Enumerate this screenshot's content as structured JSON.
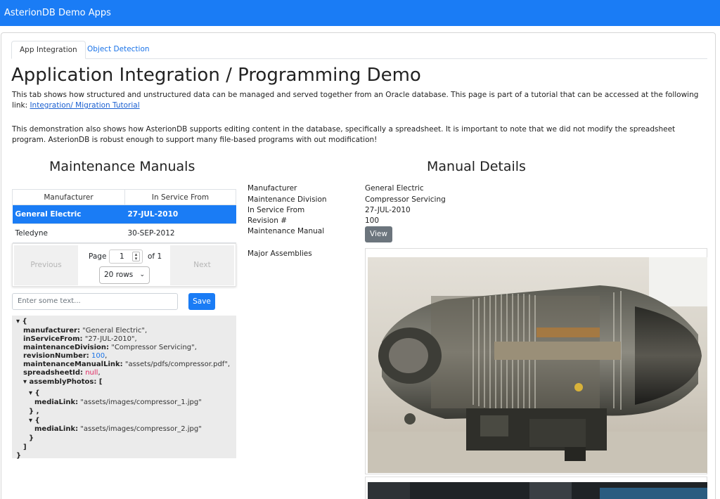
{
  "app": {
    "title": "AsterionDB Demo Apps"
  },
  "tabs": [
    {
      "label": "App Integration"
    },
    {
      "label": "Object Detection"
    }
  ],
  "page": {
    "heading": "Application Integration / Programming Demo",
    "intro": "This tab shows how structured and unstructured data can be managed and served together from an Oracle database. This page is part of a tutorial that can be accessed at the following link: ",
    "intro_link": "Integration/ Migration Tutorial",
    "note": "This demonstration also shows how AsterionDB supports editing content in the database, specifically a spreadsheet. It is important to note that we did not modify the spreadsheet program. AsterionDB is robust enough to support many file-based programs with out modification!"
  },
  "manuals": {
    "heading": "Maintenance Manuals",
    "columns": [
      "Manufacturer",
      "In Service From"
    ],
    "rows": [
      {
        "manufacturer": "General Electric",
        "in_service": "27-JUL-2010"
      },
      {
        "manufacturer": "Teledyne",
        "in_service": "30-SEP-2012"
      }
    ],
    "pager": {
      "previous": "Previous",
      "next": "Next",
      "page_label": "Page",
      "page_value": "1",
      "of_label": "of 1",
      "rows_option": "20 rows"
    },
    "editor": {
      "placeholder": "Enter some text...",
      "save": "Save"
    }
  },
  "json_view": {
    "open": "▾ {",
    "manufacturer_key": "manufacturer:",
    "manufacturer_val": "\"General Electric\",",
    "inservice_key": "inServiceFrom:",
    "inservice_val": "\"27-JUL-2010\",",
    "division_key": "maintenanceDivision:",
    "division_val": "\"Compressor Servicing\",",
    "revision_key": "revisionNumber:",
    "revision_val": "100",
    "link_key": "maintenanceManualLink:",
    "link_val": "\"assets/pdfs/compressor.pdf\",",
    "sheet_key": "spreadsheetId:",
    "sheet_val": "null",
    "photos_key": "▾ assemblyPhotos: [",
    "obj_open": "▾ {",
    "media_key": "mediaLink:",
    "media1": "\"assets/images/compressor_1.jpg\"",
    "obj_close_comma": "} ,",
    "media2": "\"assets/images/compressor_2.jpg\"",
    "obj_close": "}",
    "arr_close": "]",
    "close": "}"
  },
  "details": {
    "heading": "Manual Details",
    "manufacturer_label": "Manufacturer",
    "manufacturer": "General Electric",
    "division_label": "Maintenance Division",
    "division": "Compressor Servicing",
    "in_service_label": "In Service From",
    "in_service": "27-JUL-2010",
    "revision_label": "Revision #",
    "revision": "100",
    "manual_label": "Maintenance Manual",
    "view": "View",
    "assemblies_label": "Major Assemblies"
  },
  "colors": {
    "primary": "#1a7cf5",
    "secondary": "#6c757d"
  }
}
